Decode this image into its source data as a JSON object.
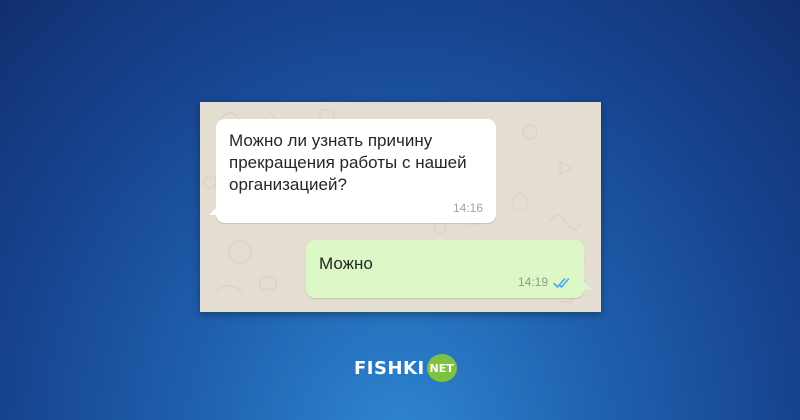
{
  "colors": {
    "incoming_bubble": "#ffffff",
    "outgoing_bubble": "#dcf8c6",
    "chat_background": "#e4ddd1",
    "read_ticks": "#4fa8e8",
    "brand_badge": "#7fc241"
  },
  "chat": {
    "messages": [
      {
        "direction": "incoming",
        "text": "Можно ли узнать причину прекращения работы с нашей организацией?",
        "time": "14:16"
      },
      {
        "direction": "outgoing",
        "text": "Можно",
        "time": "14:19",
        "status_icon": "double-check-icon"
      }
    ]
  },
  "brand": {
    "word": "FISHKI",
    "badge": "NET"
  }
}
